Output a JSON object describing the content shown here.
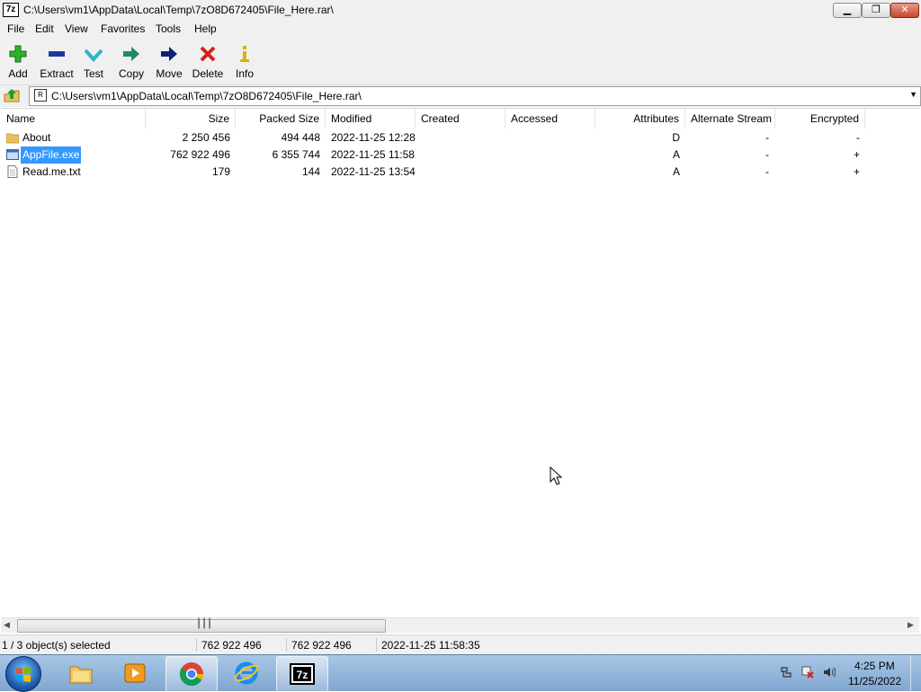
{
  "window": {
    "title": "C:\\Users\\vm1\\AppData\\Local\\Temp\\7zO8D672405\\File_Here.rar\\",
    "app_icon_text": "7z"
  },
  "menu": [
    "File",
    "Edit",
    "View",
    "Favorites",
    "Tools",
    "Help"
  ],
  "toolbar": [
    {
      "label": "Add",
      "icon": "plus-icon",
      "color": "#2ab32a"
    },
    {
      "label": "Extract",
      "icon": "minus-icon",
      "color": "#1a3aa0"
    },
    {
      "label": "Test",
      "icon": "checkmark-icon",
      "color": "#2bb6c8"
    },
    {
      "label": "Copy",
      "icon": "copy-arrow-icon",
      "color": "#1f8a6b"
    },
    {
      "label": "Move",
      "icon": "move-arrow-icon",
      "color": "#0c1f7a"
    },
    {
      "label": "Delete",
      "icon": "delete-x-icon",
      "color": "#d62020"
    },
    {
      "label": "Info",
      "icon": "info-icon",
      "color": "#d6b400"
    }
  ],
  "address": {
    "path": "C:\\Users\\vm1\\AppData\\Local\\Temp\\7zO8D672405\\File_Here.rar\\"
  },
  "columns": [
    "Name",
    "Size",
    "Packed Size",
    "Modified",
    "Created",
    "Accessed",
    "Attributes",
    "Alternate Stream",
    "Encrypted"
  ],
  "files": [
    {
      "name": "About",
      "icon": "folder-icon",
      "size": "2 250 456",
      "packed": "494 448",
      "modified": "2022-11-25 12:28",
      "created": "",
      "accessed": "",
      "attributes": "D",
      "alt_stream": "-",
      "encrypted": "-",
      "selected": false
    },
    {
      "name": "AppFile.exe",
      "icon": "exe-file-icon",
      "size": "762 922 496",
      "packed": "6 355 744",
      "modified": "2022-11-25 11:58",
      "created": "",
      "accessed": "",
      "attributes": "A",
      "alt_stream": "-",
      "encrypted": "+",
      "selected": true
    },
    {
      "name": "Read.me.txt",
      "icon": "text-file-icon",
      "size": "179",
      "packed": "144",
      "modified": "2022-11-25 13:54",
      "created": "",
      "accessed": "",
      "attributes": "A",
      "alt_stream": "-",
      "encrypted": "+",
      "selected": false
    }
  ],
  "status": {
    "selection": "1 / 3 object(s) selected",
    "size": "762 922 496",
    "packed": "762 922 496",
    "modified": "2022-11-25 11:58:35"
  },
  "taskbar": {
    "apps": [
      {
        "name": "explorer",
        "icon": "file-explorer-icon"
      },
      {
        "name": "media-player",
        "icon": "media-player-icon"
      },
      {
        "name": "chrome",
        "icon": "chrome-icon"
      },
      {
        "name": "internet-explorer",
        "icon": "internet-explorer-icon"
      },
      {
        "name": "7zip",
        "icon": "7zip-icon",
        "active": true
      }
    ],
    "clock_time": "4:25 PM",
    "clock_date": "11/25/2022"
  }
}
